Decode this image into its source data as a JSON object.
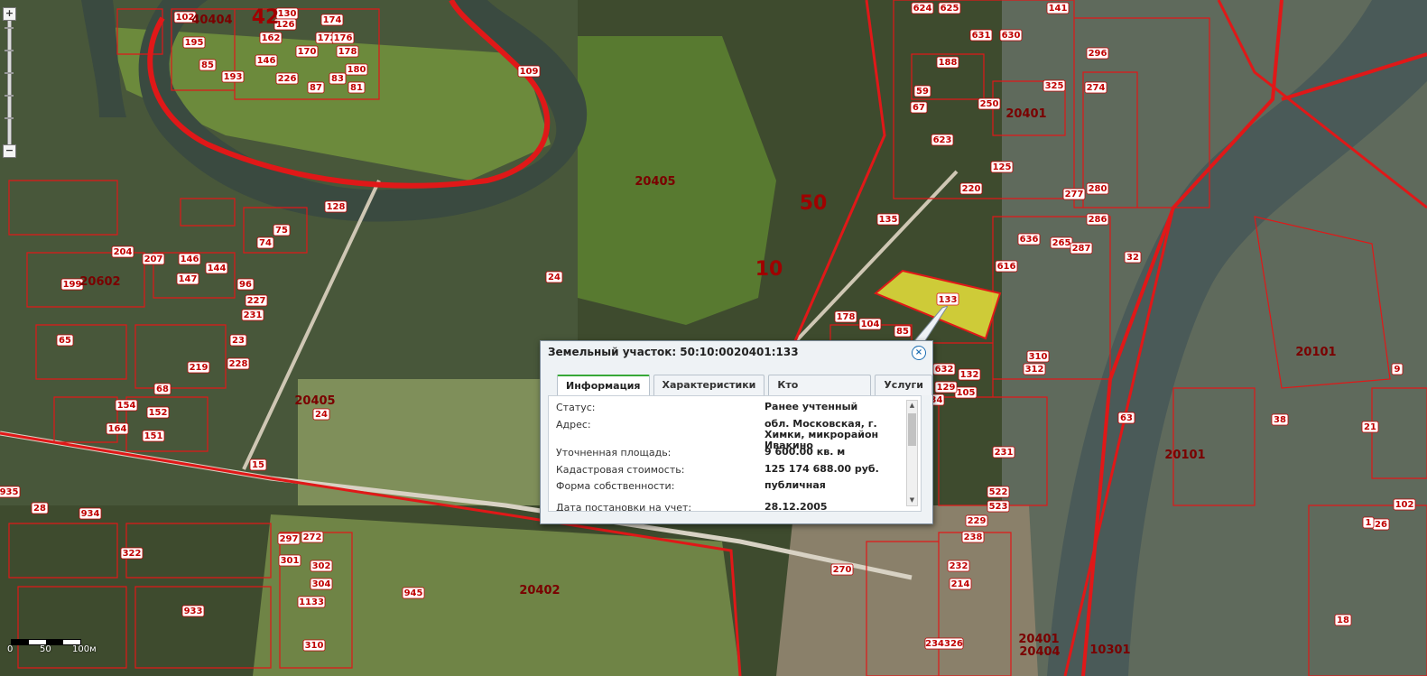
{
  "map": {
    "quarter_labels": [
      "40404",
      "42",
      "20602",
      "20405",
      "20405",
      "50",
      "10",
      "20401",
      "20402",
      "20101",
      "20101",
      "20401",
      "10301",
      "20404"
    ],
    "parcel_labels": [
      "102",
      "195",
      "193",
      "85",
      "109",
      "146",
      "170",
      "172",
      "162",
      "130",
      "126",
      "174",
      "176",
      "178",
      "180",
      "81",
      "83",
      "87",
      "226",
      "128",
      "75",
      "74",
      "204",
      "207",
      "199",
      "146",
      "144",
      "147",
      "96",
      "227",
      "231",
      "65",
      "68",
      "152",
      "154",
      "164",
      "151",
      "219",
      "228",
      "23",
      "15",
      "24",
      "28",
      "934",
      "933",
      "945",
      "301",
      "302",
      "304",
      "1133",
      "310",
      "272",
      "322",
      "297",
      "24",
      "624",
      "625",
      "631",
      "630",
      "141",
      "188",
      "325",
      "250",
      "59",
      "67",
      "623",
      "220",
      "135",
      "125",
      "636",
      "616",
      "286",
      "265",
      "287",
      "274",
      "280",
      "277",
      "296",
      "32",
      "63",
      "38",
      "21",
      "26",
      "270",
      "231",
      "522",
      "523",
      "238",
      "229",
      "232",
      "214",
      "234326",
      "632",
      "132",
      "105",
      "129",
      "134",
      "104",
      "178",
      "85",
      "310",
      "312",
      "935",
      "1",
      "18",
      "9",
      "102",
      "63"
    ],
    "highlighted_parcel": "133",
    "scale": {
      "zero": "0",
      "mid": "50",
      "end": "100м"
    },
    "zoom": {
      "plus": "+",
      "minus": "−"
    }
  },
  "popup": {
    "title": "Земельный участок: 50:10:0020401:133",
    "close": "×",
    "tabs": [
      {
        "label": "Информация",
        "active": true
      },
      {
        "label": "Характеристики",
        "active": false
      },
      {
        "label": "Кто обслуживает?",
        "active": false
      },
      {
        "label": "Услуги",
        "active": false
      }
    ],
    "rows": [
      {
        "key": "Статус:",
        "value": "Ранее учтенный"
      },
      {
        "key": "Адрес:",
        "value": "обл. Московская, г. Химки, микрорайон Ивакино"
      },
      {
        "key": "Уточненная площадь:",
        "value": "9 600.00 кв. м"
      },
      {
        "key": "Кадастровая стоимость:",
        "value": "125 174 688.00 руб."
      },
      {
        "key": "Форма собственности:",
        "value": "публичная"
      },
      {
        "key": "Дата постановки на учет:",
        "value": "28.12.2005"
      }
    ]
  },
  "colors": {
    "boundary": "#e01818",
    "highlight": "#e8e23a",
    "river": "#4a5a58"
  }
}
